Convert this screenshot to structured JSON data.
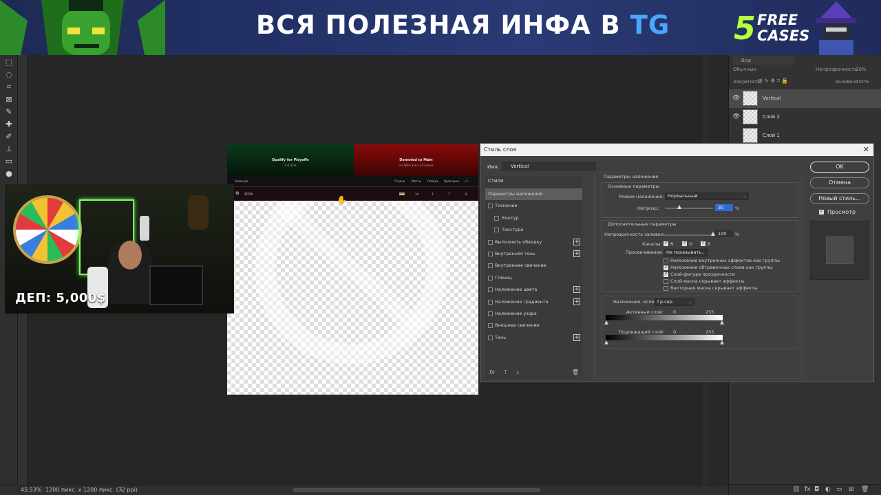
{
  "banner": {
    "title_main": "ВСЯ ПОЛЕЗНАЯ ИНФА В",
    "title_accent": "TG",
    "promo_number": "5",
    "promo_text_line1": "FREE",
    "promo_text_line2": "CASES"
  },
  "stream": {
    "deposit_text": "ДЕП: 5,000$"
  },
  "statusbar": {
    "zoom": "45.53%",
    "docsize": "1200 пикс. x 1200 пикс. (72 ppi)",
    "arrow": "›"
  },
  "layers_panel": {
    "search_placeholder": "Вид",
    "blend_mode": "Обычные",
    "opacity_label": "Непрозрачность:",
    "opacity_value": "20%",
    "lock_label": "Закрепить:",
    "fill_label": "Заливка:",
    "fill_value": "100%",
    "layers": [
      {
        "name": "Vertical",
        "visible": true,
        "active": true
      },
      {
        "name": "Слой 2",
        "visible": true,
        "active": false
      },
      {
        "name": "Слой 1",
        "visible": false,
        "active": false
      }
    ]
  },
  "document": {
    "qualify_title": "Qualify for Playoffs",
    "qualify_sub": "1-й 32-й",
    "demoted_title": "Demoted to Main",
    "demoted_sub": "0-3 Wins and +10 Losses",
    "col_team": "Команда",
    "col_country": "Страна",
    "col_matches": "Матчи",
    "col_wins": "Победа",
    "col_losses": "Проигрыш",
    "col_diff": "+/-",
    "row_team": "ZOTIX",
    "row_matches": "14",
    "row_wins": "7",
    "row_losses": "7",
    "row_diff": "0"
  },
  "dialog": {
    "title": "Стиль слоя",
    "close": "✕",
    "name_label": "Имя:",
    "name_value": "Vertical",
    "styles_header": "Стили",
    "styles": [
      {
        "label": "Параметры наложения",
        "active": true,
        "checkbox": false,
        "indent": false,
        "plus": false
      },
      {
        "label": "Тиснение",
        "active": false,
        "checkbox": true,
        "indent": false,
        "plus": false
      },
      {
        "label": "Контур",
        "active": false,
        "checkbox": true,
        "indent": true,
        "plus": false
      },
      {
        "label": "Текстура",
        "active": false,
        "checkbox": true,
        "indent": true,
        "plus": false
      },
      {
        "label": "Выполнить обводку",
        "active": false,
        "checkbox": true,
        "indent": false,
        "plus": true
      },
      {
        "label": "Внутренняя тень",
        "active": false,
        "checkbox": true,
        "indent": false,
        "plus": true
      },
      {
        "label": "Внутреннее свечение",
        "active": false,
        "checkbox": true,
        "indent": false,
        "plus": false
      },
      {
        "label": "Глянец",
        "active": false,
        "checkbox": true,
        "indent": false,
        "plus": false
      },
      {
        "label": "Наложение цвета",
        "active": false,
        "checkbox": true,
        "indent": false,
        "plus": true
      },
      {
        "label": "Наложение градиента",
        "active": false,
        "checkbox": true,
        "indent": false,
        "plus": true
      },
      {
        "label": "Наложение узора",
        "active": false,
        "checkbox": true,
        "indent": false,
        "plus": false
      },
      {
        "label": "Внешнее свечение",
        "active": false,
        "checkbox": true,
        "indent": false,
        "plus": false
      },
      {
        "label": "Тень",
        "active": false,
        "checkbox": true,
        "indent": false,
        "plus": true
      }
    ],
    "params_title": "Параметры наложения",
    "general_title": "Основные параметры",
    "blend_mode_label": "Режим наложения:",
    "blend_mode_value": "Нормальный",
    "opacity_label": "Непрозр.:",
    "opacity_value": "30",
    "opacity_fraction": 0.3,
    "percent": "%",
    "advanced_title": "Дополнительные параметры",
    "fill_opacity_label": "Непрозрачность заливки:",
    "fill_opacity_value": "100",
    "fill_opacity_fraction": 1.0,
    "channels_label": "Каналы:",
    "channel_r": "R",
    "channel_g": "G",
    "channel_b": "B",
    "knockout_label": "Просвечивание:",
    "knockout_value": "Не показывать",
    "options": [
      {
        "label": "Наложение внутренних эффектов как группы",
        "checked": false
      },
      {
        "label": "Наложение обтравочных слоев как группы",
        "checked": true
      },
      {
        "label": "Слой-фигура прозрачности",
        "checked": true
      },
      {
        "label": "Слой-маска скрывает эффекты",
        "checked": false
      },
      {
        "label": "Векторная маска скрывает эффекты",
        "checked": false
      }
    ],
    "blend_if_label": "Наложение, если:",
    "blend_if_value": "Гр.сер.",
    "this_layer_label": "Активный слой:",
    "underlying_label": "Подлежащий слой:",
    "range_min": "0",
    "range_max": "255",
    "btn_ok": "OK",
    "btn_cancel": "Отмена",
    "btn_new_style": "Новый стиль...",
    "preview_label": "Просмотр",
    "preview_checked": true
  }
}
